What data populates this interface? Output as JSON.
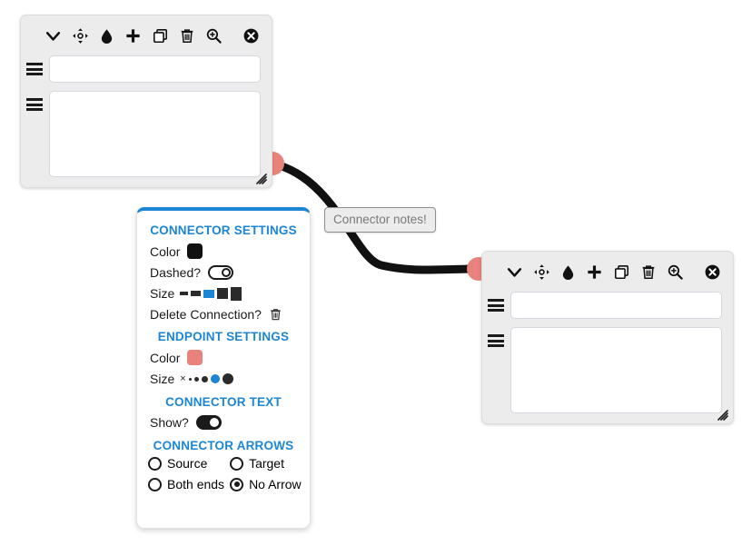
{
  "canvas": {
    "background": "#ffffff",
    "accent_blue": "#1c86d4",
    "endpoint_color": "#e8827c",
    "connector_color": "#111111",
    "node_background": "#ececec"
  },
  "connector": {
    "label": "Connector notes!",
    "label_color": "#7a7a7a"
  },
  "node_toolbar": {
    "icons": [
      {
        "name": "chevron-down-icon",
        "title": "Collapse"
      },
      {
        "name": "move-icon",
        "title": "Move"
      },
      {
        "name": "droplet-icon",
        "title": "Color"
      },
      {
        "name": "plus-icon",
        "title": "Add"
      },
      {
        "name": "copy-icon",
        "title": "Duplicate"
      },
      {
        "name": "trash-icon",
        "title": "Delete"
      },
      {
        "name": "zoom-in-icon",
        "title": "Zoom"
      },
      {
        "name": "close-icon",
        "title": "Close"
      }
    ]
  },
  "node_one": {
    "title_value": "",
    "title_placeholder": "",
    "body_value": "",
    "body_placeholder": ""
  },
  "node_two": {
    "title_value": "",
    "title_placeholder": "",
    "body_value": "",
    "body_placeholder": ""
  },
  "settings": {
    "connector_settings_title": "CONNECTOR SETTINGS",
    "color_label": "Color",
    "connector_color_value": "#111111",
    "dashed_label": "Dashed?",
    "dashed_on": false,
    "size_label": "Size",
    "connector_sizes": [
      {
        "index": 1,
        "selected": false
      },
      {
        "index": 2,
        "selected": false
      },
      {
        "index": 3,
        "selected": true
      },
      {
        "index": 4,
        "selected": false
      },
      {
        "index": 5,
        "selected": false
      }
    ],
    "delete_connection_label": "Delete Connection?",
    "delete_icon": "trash-icon",
    "endpoint_settings_title": "ENDPOINT SETTINGS",
    "endpoint_color_label": "Color",
    "endpoint_color_value": "#e8827c",
    "endpoint_size_label": "Size",
    "endpoint_sizes": [
      {
        "index": 0,
        "glyph": "×",
        "selected": false
      },
      {
        "index": 1,
        "selected": false
      },
      {
        "index": 2,
        "selected": false
      },
      {
        "index": 3,
        "selected": false
      },
      {
        "index": 4,
        "selected": true
      },
      {
        "index": 5,
        "selected": false
      }
    ],
    "connector_text_title": "CONNECTOR TEXT",
    "show_label": "Show?",
    "show_on": true,
    "connector_arrows_title": "CONNECTOR ARROWS",
    "arrow_options": [
      {
        "label": "Source",
        "selected": false
      },
      {
        "label": "Target",
        "selected": false
      },
      {
        "label": "Both ends",
        "selected": false
      },
      {
        "label": "No Arrow",
        "selected": true
      }
    ]
  }
}
